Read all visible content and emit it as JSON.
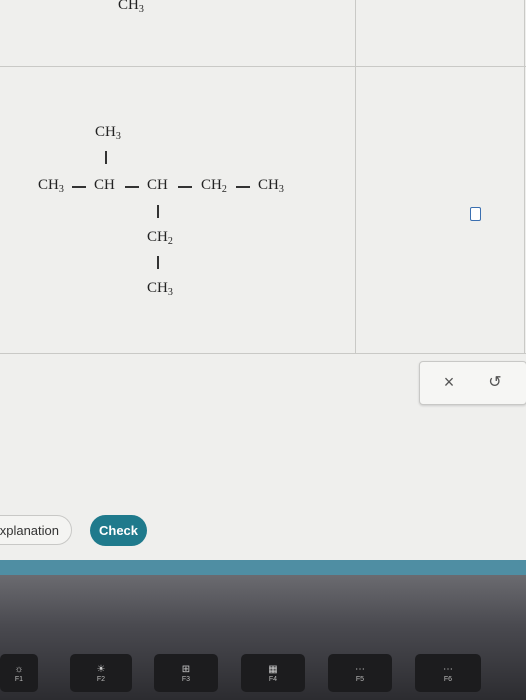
{
  "formula": {
    "top_cut": "CH3",
    "branch_top": "CH3",
    "main_chain": [
      "CH3",
      "CH",
      "CH",
      "CH2",
      "CH3"
    ],
    "branch_down_1": "CH2",
    "branch_down_2": "CH3"
  },
  "tools": {
    "clear_label": "×",
    "undo_label": "↺"
  },
  "buttons": {
    "explanation": "xplanation",
    "check": "Check"
  },
  "keyboard": {
    "keys": [
      {
        "glyph": "☼",
        "label": "F1"
      },
      {
        "glyph": "☀",
        "label": "F2"
      },
      {
        "glyph": "⊞",
        "label": "F3"
      },
      {
        "glyph": "▦",
        "label": "F4"
      },
      {
        "glyph": "⋯",
        "label": "F5"
      },
      {
        "glyph": "⋯",
        "label": "F6"
      }
    ]
  }
}
